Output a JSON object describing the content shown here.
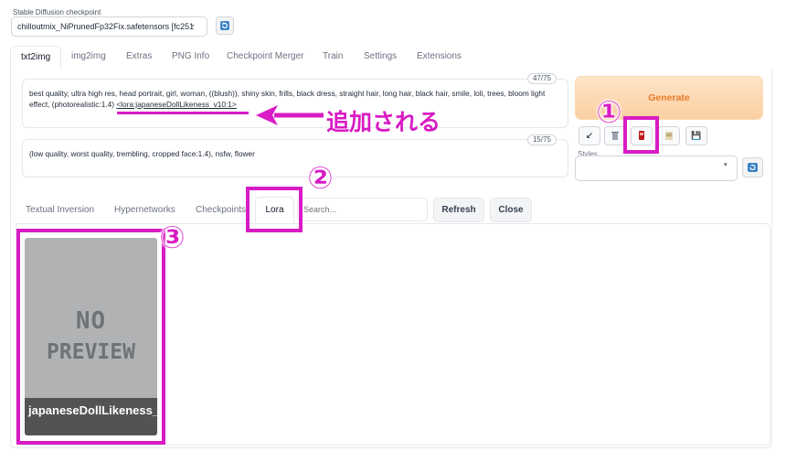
{
  "checkpoint": {
    "label": "Stable Diffusion checkpoint",
    "value": "chilloutmix_NiPrunedFp32Fix.safetensors [fc251",
    "chevron": "⌄"
  },
  "tabs": [
    "txt2img",
    "img2img",
    "Extras",
    "PNG Info",
    "Checkpoint Merger",
    "Train",
    "Settings",
    "Extensions"
  ],
  "prompt": {
    "text": "best quality, ultra high res, head portrait, girl, woman, ((blush)), shiny skin, frills, black dress, straight hair, long hair, black hair, smile, loli, trees, bloom light effect, (photorealistic:1.4) ",
    "lora_tag": "<lora:japaneseDollLikeness_v10:1>",
    "counter": "47/75"
  },
  "negative_prompt": {
    "text": "(low quality, worst quality, trembling, cropped face:1.4), nsfw, flower",
    "counter": "15/75"
  },
  "generate": {
    "label": "Generate"
  },
  "tools": {
    "arrow": "↙",
    "save": "💾"
  },
  "styles": {
    "label": "Styles",
    "caret": "▾"
  },
  "extra_networks": {
    "tabs": [
      "Textual Inversion",
      "Hypernetworks",
      "Checkpoints"
    ],
    "active_tab": "Lora",
    "search_placeholder": "Search...",
    "refresh": "Refresh",
    "close": "Close"
  },
  "card": {
    "no_preview_line1": "NO",
    "no_preview_line2": "PREVIEW",
    "name": "japaneseDollLikeness_v10"
  },
  "annotations": {
    "added_text": "追加される",
    "n1": "①",
    "n2": "②",
    "n3": "③",
    "accent": "#d81bc4"
  }
}
